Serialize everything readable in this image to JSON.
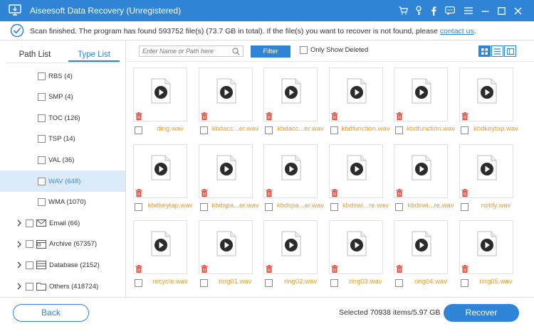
{
  "window": {
    "title": "Aiseesoft Data Recovery (Unregistered)"
  },
  "scan": {
    "message": "Scan finished. The program has found 593752 file(s) (73.7 GB in total). If the file(s) you want to recover is not found, please ",
    "link_text": "contact us",
    "suffix": "."
  },
  "tabs": {
    "path_list": "Path List",
    "type_list": "Type List"
  },
  "tree": {
    "audio_items": [
      {
        "label": "RBS (4)",
        "selected": false
      },
      {
        "label": "SMP (4)",
        "selected": false
      },
      {
        "label": "TOC (126)",
        "selected": false
      },
      {
        "label": "TSP (14)",
        "selected": false
      },
      {
        "label": "VAL (36)",
        "selected": false
      },
      {
        "label": "WAV (648)",
        "selected": true
      },
      {
        "label": "WMA (1070)",
        "selected": false
      }
    ],
    "categories": [
      {
        "label": "Email (66)",
        "icon": "envelope-icon"
      },
      {
        "label": "Archive (67357)",
        "icon": "archive-icon"
      },
      {
        "label": "Database (2152)",
        "icon": "database-icon"
      },
      {
        "label": "Others (418724)",
        "icon": "folder-icon"
      }
    ]
  },
  "toolbar": {
    "search_placeholder": "Enter Name or Path here",
    "filter_label": "Filter",
    "only_deleted_label": "Only Show Deleted",
    "views": [
      "thumbnail-view-icon",
      "list-view-icon",
      "detail-view-icon"
    ]
  },
  "files": [
    "ding.wav",
    "kbdacc...er.wav",
    "kbdacc...er.wav",
    "kbdfunction.wav",
    "kbdfunction.wav",
    "kbdkeytap.wav",
    "kbdkeytap.wav",
    "kbdspa...er.wav",
    "kbdspa...ar.wav",
    "kbdswi...re.wav",
    "kbdswi...re.wav",
    "notify.wav",
    "recycle.wav",
    "ring01.wav",
    "ring02.wav",
    "ring03.wav",
    "ring04.wav",
    "ring05.wav"
  ],
  "footer": {
    "back_label": "Back",
    "selected_info": "Selected 70938 items/5.97 GB",
    "recover_label": "Recover"
  },
  "colors": {
    "accent": "#2f84d6",
    "file_name": "#f29b22",
    "deleted_icon": "#e04a3a",
    "selected_row": "#dcebfa"
  }
}
